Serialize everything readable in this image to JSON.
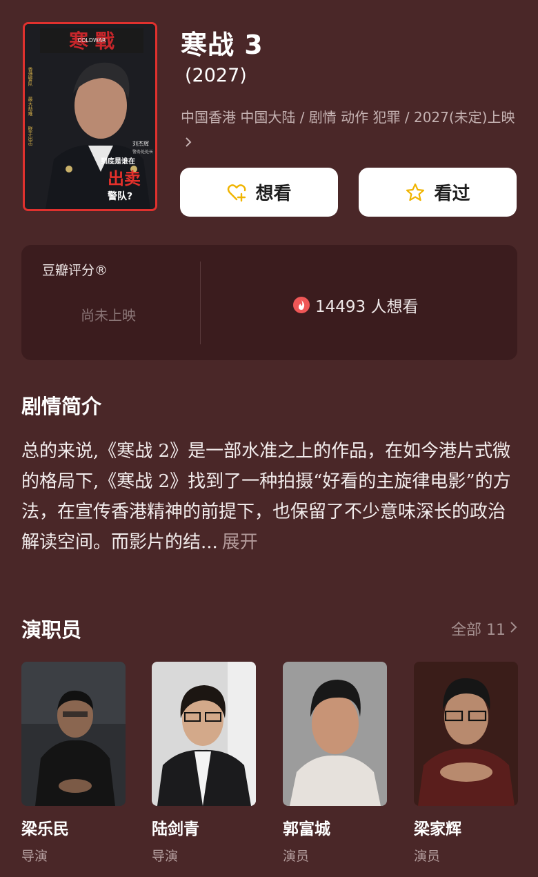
{
  "movie": {
    "title": "寒战 3",
    "year": "(2027)",
    "meta_line": "中国香港 中国大陆 / 剧情 动作 犯罪 / 2027(未定)上映",
    "poster": {
      "logo_text": "寒 戰",
      "logo_sub": "COLDWAR",
      "actor_name": "刘杰辉",
      "actor_title": "警务处处长",
      "tagline_1": "到底是谁在",
      "tagline_2": "出卖",
      "tagline_3": "警队?",
      "side_text_1": "香港警队",
      "side_text_2": "最大劫难",
      "side_text_3": "联手出击"
    }
  },
  "actions": {
    "want_label": "想看",
    "seen_label": "看过",
    "want_icon": "heart-plus-icon",
    "seen_icon": "star-icon"
  },
  "rating": {
    "label": "豆瓣评分®",
    "status": "尚未上映",
    "wish_count_text": "14493 人想看",
    "wish_icon": "fire-icon"
  },
  "synopsis": {
    "heading": "剧情简介",
    "text": "总的来说,《寒战 2》是一部水准之上的作品，在如今港片式微的格局下,《寒战 2》找到了一种拍摄“好看的主旋律电影”的方法，在宣传香港精神的前提下，也保留了不少意味深长的政治解读空间。而影片的结...",
    "expand_label": "展开"
  },
  "cast": {
    "heading": "演职员",
    "all_label": "全部 11",
    "members": [
      {
        "name": "梁乐民",
        "role": "导演"
      },
      {
        "name": "陆剑青",
        "role": "导演"
      },
      {
        "name": "郭富城",
        "role": "演员"
      },
      {
        "name": "梁家辉",
        "role": "演员"
      }
    ]
  },
  "colors": {
    "background": "#4a2728",
    "card": "#3b1c1e",
    "poster_border": "#e0312e",
    "button_bg": "#ffffff",
    "icon_accent": "#f0b400",
    "fire": "#ef5757"
  }
}
